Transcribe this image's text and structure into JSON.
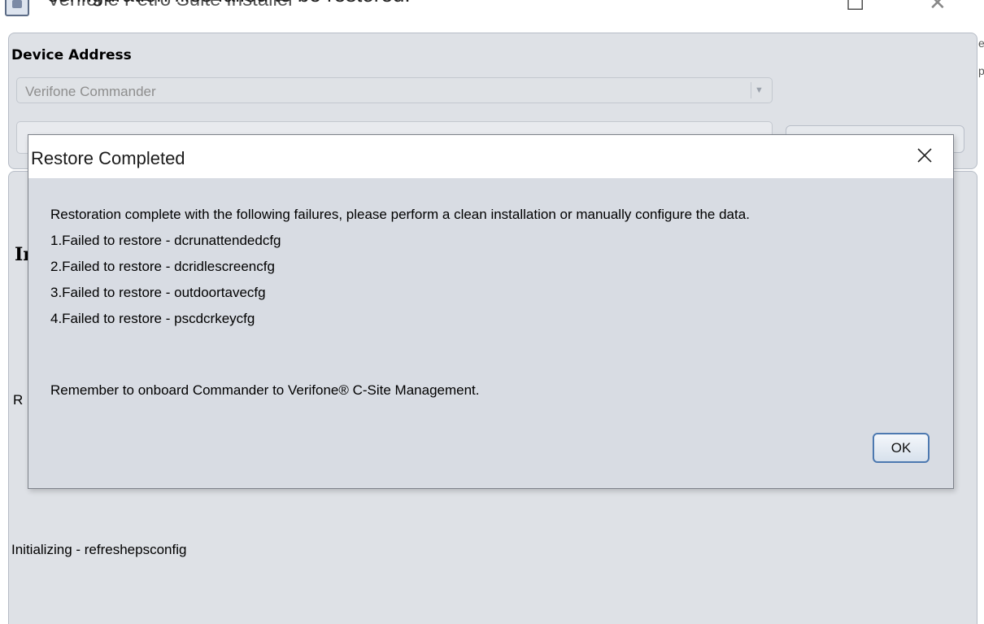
{
  "window": {
    "title": "Verifone Petro Suite Installer",
    "overlay_caption": "configuration files failed to be restored.",
    "maximize_glyph": "☐",
    "close_glyph": "✕",
    "edge_glyphs": [
      "e",
      "p"
    ]
  },
  "device_panel": {
    "label": "Device Address",
    "selected_device": "Verifone Commander",
    "dropdown_glyph": "▼",
    "address_value": "",
    "button_label": ""
  },
  "background": {
    "heading_partial": "Initializing",
    "r_partial": "R",
    "status_text": "Initializing - refreshepsconfig"
  },
  "dialog": {
    "title": "Restore Completed",
    "message_lines": [
      "Restoration complete with the following failures, please perform a clean installation or manually configure the data.",
      "1.Failed to restore - dcrunattendedcfg",
      "2.Failed to restore - dcridlescreencfg",
      "3.Failed to restore - outdoortavecfg",
      "4.Failed to restore - pscdcrkeycfg"
    ],
    "footer_message": "Remember to onboard Commander to Verifone® C-Site Management.",
    "ok_label": "OK"
  },
  "colors": {
    "panel_bg": "#dee1e6",
    "dialog_bg": "#d8dce3",
    "ok_border": "#4d79b0"
  },
  "icons": {
    "app": "installer-app-icon",
    "dialog_close": "close-x-icon",
    "dropdown": "chevron-down-icon"
  }
}
